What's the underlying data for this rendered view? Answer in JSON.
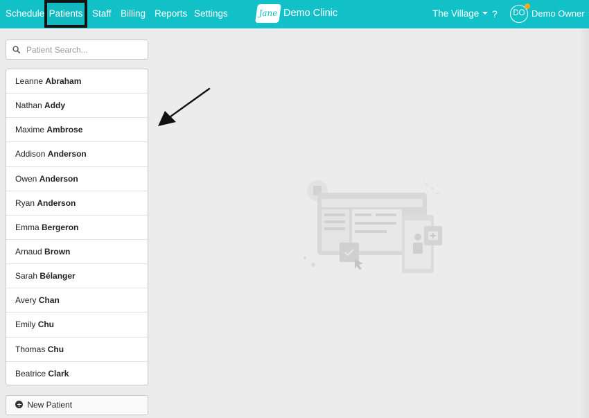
{
  "nav": {
    "items": [
      {
        "label": "Schedule"
      },
      {
        "label": "Patients"
      },
      {
        "label": "Staff"
      },
      {
        "label": "Billing"
      },
      {
        "label": "Reports"
      },
      {
        "label": "Settings"
      }
    ],
    "active": "Patients"
  },
  "brand": {
    "logo_text": "Jane",
    "clinic_name": "Demo Clinic"
  },
  "location": {
    "label": "The Village"
  },
  "help": {
    "label": "?"
  },
  "user": {
    "initials": "DO",
    "name": "Demo Owner"
  },
  "search": {
    "placeholder": "Patient Search..."
  },
  "patients": [
    {
      "first": "Leanne",
      "last": "Abraham"
    },
    {
      "first": "Nathan",
      "last": "Addy"
    },
    {
      "first": "Maxime",
      "last": "Ambrose"
    },
    {
      "first": "Addison",
      "last": "Anderson"
    },
    {
      "first": "Owen",
      "last": "Anderson"
    },
    {
      "first": "Ryan",
      "last": "Anderson"
    },
    {
      "first": "Emma",
      "last": "Bergeron"
    },
    {
      "first": "Arnaud",
      "last": "Brown"
    },
    {
      "first": "Sarah",
      "last": "Bélanger"
    },
    {
      "first": "Avery",
      "last": "Chan"
    },
    {
      "first": "Emily",
      "last": "Chu"
    },
    {
      "first": "Thomas",
      "last": "Chu"
    },
    {
      "first": "Beatrice",
      "last": "Clark"
    }
  ],
  "new_patient": {
    "label": "New Patient"
  },
  "colors": {
    "topbar": "#12c0c8",
    "highlight_box": "#141414",
    "notification_dot": "#f5a623",
    "canvas": "#ececec"
  }
}
